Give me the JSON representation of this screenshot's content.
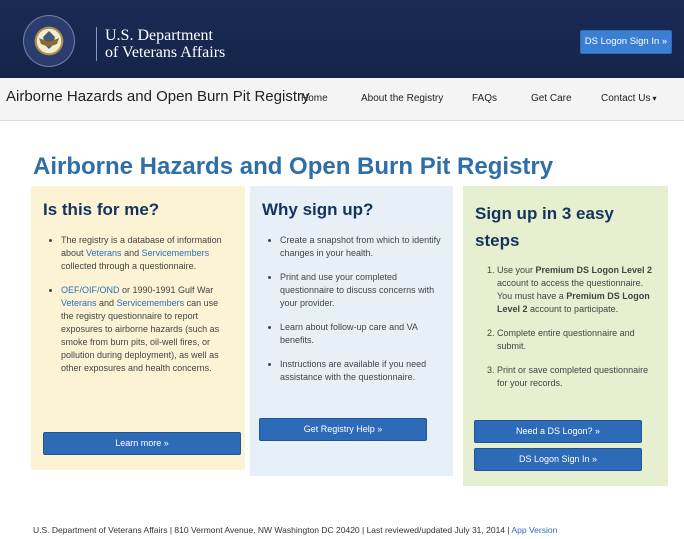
{
  "header": {
    "dept_line1": "U.S. Department",
    "dept_line2": "of Veterans Affairs",
    "signin_button": "DS Logon Sign In »"
  },
  "nav": {
    "site_title": "Airborne Hazards and Open Burn Pit Registry",
    "items": [
      {
        "label": "Home"
      },
      {
        "label": "About the Registry"
      },
      {
        "label": "FAQs"
      },
      {
        "label": "Get Care"
      },
      {
        "label": "Contact Us"
      }
    ]
  },
  "main": {
    "title": "Airborne Hazards and Open Burn Pit Registry",
    "col1": {
      "heading": "Is this for me?",
      "b1_pre": "The registry is a database of information about ",
      "b1_link1": "Veterans",
      "b1_mid": " and ",
      "b1_link2": "Servicemembers",
      "b1_post": " collected through a questionnaire.",
      "b2_link1": "OEF/OIF/OND",
      "b2_mid1": " or 1990-1991 Gulf War ",
      "b2_link2": "Veterans",
      "b2_mid2": " and ",
      "b2_link3": "Servicemembers",
      "b2_post": " can use the registry questionnaire to report exposures to airborne hazards (such as smoke from burn pits, oil-well fires, or pollution during deployment), as well as other exposures and health concerns.",
      "button": "Learn more »"
    },
    "col2": {
      "heading": "Why sign up?",
      "bullets": [
        "Create a snapshot from which to identify changes in your health.",
        "Print and use your completed questionnaire to discuss concerns with your provider.",
        "Learn about follow-up care and VA benefits.",
        "Instructions are available if you need assistance with the questionnaire."
      ],
      "button": "Get Registry Help »"
    },
    "col3": {
      "heading": "Sign up in 3 easy steps",
      "s1_pre": "Use your ",
      "s1_bold1": "Premium DS Logon Level 2",
      "s1_mid": " account to access the questionnaire. You must have a ",
      "s1_bold2": "Premium DS Logon Level 2",
      "s1_post": " account to participate.",
      "s2": "Complete entire questionnaire and submit.",
      "s3": "Print or save completed questionnaire for your records.",
      "button_need": "Need a DS Logon? »",
      "button_signin": "DS Logon Sign In »"
    }
  },
  "footer": {
    "text": "U.S. Department of Veterans Affairs | 810 Vermont Avenue, NW Washington DC 20420 | Last reviewed/updated July 31, 2014 | ",
    "link": "App Version"
  },
  "colors": {
    "header_bg": "#1a2a55",
    "accent_blue": "#2d6bb8",
    "title_blue": "#2f6fa8",
    "col1_bg": "#fbf3d4",
    "col2_bg": "#e7f0f7",
    "col3_bg": "#e6f0d0"
  },
  "icons": [
    "va-seal-logo",
    "caret-down-icon"
  ]
}
